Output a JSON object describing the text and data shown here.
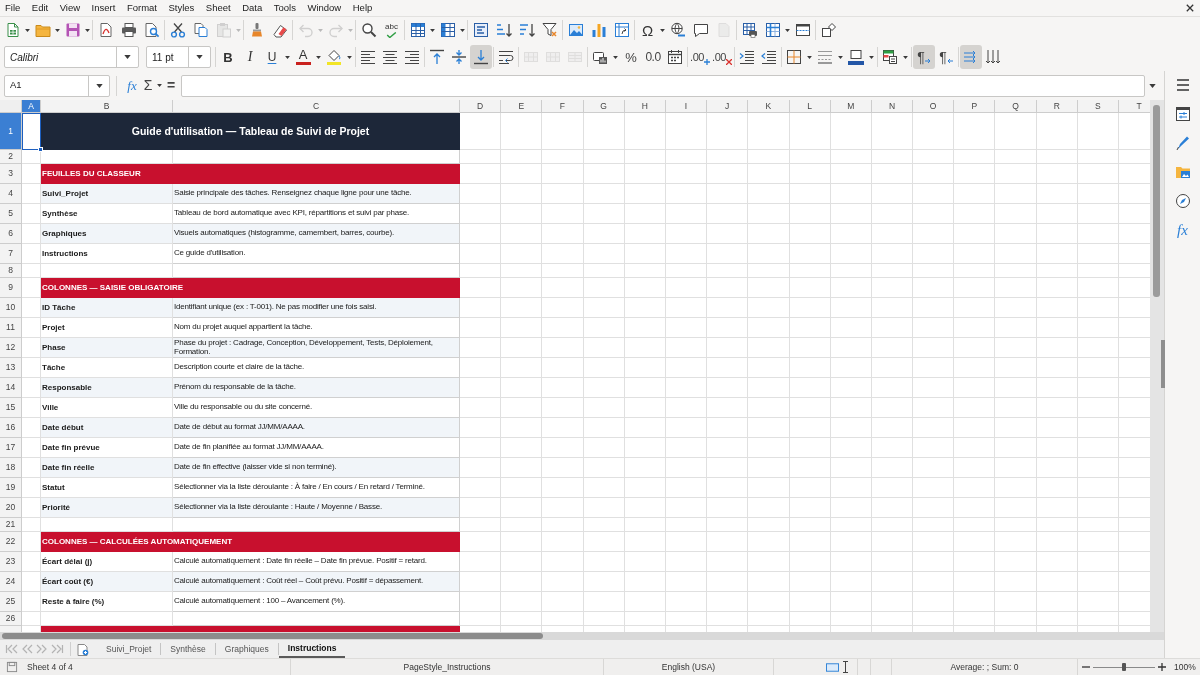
{
  "menu_bar": [
    "File",
    "Edit",
    "View",
    "Insert",
    "Format",
    "Styles",
    "Sheet",
    "Data",
    "Tools",
    "Window",
    "Help"
  ],
  "standard_toolbar": [
    {
      "dropdown": true,
      "disabled": false
    },
    {
      "dropdown": true,
      "disabled": false
    },
    {
      "dropdown": true,
      "disabled": false
    },
    {
      "dropdown": false,
      "disabled": false
    },
    {
      "dropdown": false,
      "disabled": false
    },
    {
      "dropdown": false,
      "disabled": false
    },
    {
      "dropdown": false,
      "disabled": false
    },
    {
      "dropdown": false,
      "disabled": false
    },
    {
      "dropdown": true,
      "disabled": true
    },
    {
      "dropdown": false,
      "disabled": false
    },
    {
      "dropdown": false,
      "disabled": false
    },
    {
      "dropdown": true,
      "disabled": true
    },
    {
      "dropdown": true,
      "disabled": true
    },
    {
      "dropdown": false,
      "disabled": false
    },
    {
      "glyph": "abc",
      "dropdown": false,
      "disabled": false
    },
    {
      "dropdown": true,
      "disabled": false
    },
    {
      "dropdown": true,
      "disabled": false
    },
    {
      "dropdown": false,
      "disabled": false
    },
    {
      "dropdown": false,
      "disabled": false
    },
    {
      "dropdown": false,
      "disabled": false
    },
    {
      "dropdown": false,
      "disabled": false
    },
    {
      "dropdown": false,
      "disabled": false
    },
    {
      "dropdown": false,
      "disabled": false
    },
    {
      "dropdown": false,
      "disabled": false
    },
    {
      "glyph": "Ω",
      "dropdown": true,
      "disabled": false
    },
    {
      "dropdown": false,
      "disabled": false
    },
    {
      "dropdown": false,
      "disabled": false
    },
    {
      "dropdown": false,
      "disabled": true
    },
    {
      "dropdown": false,
      "disabled": false
    },
    {
      "dropdown": true,
      "disabled": false
    },
    {
      "dropdown": false,
      "disabled": false
    },
    {
      "dropdown": false,
      "disabled": false
    }
  ],
  "formatting_toolbar": {
    "font_name": "Calibri",
    "font_size": "11 pt",
    "buttons": [
      {
        "glyph": "B",
        "dropdown": false,
        "disabled": false,
        "active": false
      },
      {
        "glyph": "I",
        "dropdown": false,
        "disabled": false,
        "active": false
      },
      {
        "glyph": "U",
        "dropdown": true,
        "disabled": false,
        "active": false
      },
      {
        "glyph": "A",
        "dropdown": true,
        "disabled": false,
        "active": false
      },
      {
        "dropdown": true,
        "disabled": false,
        "active": false
      },
      {
        "dropdown": false,
        "disabled": false,
        "active": false
      },
      {
        "dropdown": false,
        "disabled": false,
        "active": false
      },
      {
        "dropdown": false,
        "disabled": false,
        "active": false
      },
      {
        "dropdown": false,
        "disabled": false,
        "active": false
      },
      {
        "dropdown": false,
        "disabled": false,
        "active": false
      },
      {
        "dropdown": false,
        "disabled": false,
        "active": true
      },
      {
        "dropdown": false,
        "disabled": false,
        "active": false
      },
      {
        "dropdown": false,
        "disabled": true,
        "active": false
      },
      {
        "dropdown": false,
        "disabled": true,
        "active": false
      },
      {
        "dropdown": false,
        "disabled": true,
        "active": false
      },
      {
        "dropdown": true,
        "disabled": false,
        "active": false
      },
      {
        "glyph": "%",
        "dropdown": false,
        "disabled": false,
        "active": false
      },
      {
        "glyph": "0.0",
        "dropdown": false,
        "disabled": false,
        "active": false
      },
      {
        "dropdown": false,
        "disabled": false,
        "active": false
      },
      {
        "glyph": ".00",
        "dropdown": false,
        "disabled": false,
        "active": false
      },
      {
        "glyph": ".00",
        "dropdown": false,
        "disabled": false,
        "active": false
      },
      {
        "dropdown": false,
        "disabled": false,
        "active": false
      },
      {
        "dropdown": false,
        "disabled": false,
        "active": false
      },
      {
        "dropdown": true,
        "disabled": false,
        "active": false
      },
      {
        "dropdown": true,
        "disabled": false,
        "active": false
      },
      {
        "dropdown": true,
        "disabled": false,
        "active": false
      },
      {
        "dropdown": true,
        "disabled": false,
        "active": false
      },
      {
        "glyph": "¶",
        "dropdown": false,
        "disabled": false,
        "active": true
      },
      {
        "glyph": "¶",
        "dropdown": false,
        "disabled": false,
        "active": false
      },
      {
        "dropdown": false,
        "disabled": false,
        "active": true
      },
      {
        "dropdown": false,
        "disabled": false,
        "active": false
      }
    ]
  },
  "formula_bar": {
    "name_box": "A1",
    "function_glyph": "fx",
    "sum_glyph": "Σ",
    "equals_glyph": "="
  },
  "grid": {
    "columns": [
      {
        "label": "A",
        "selected": true
      },
      {
        "label": "B",
        "selected": false
      },
      {
        "label": "C",
        "selected": false
      },
      {
        "label": "D",
        "selected": false
      },
      {
        "label": "E",
        "selected": false
      },
      {
        "label": "F",
        "selected": false
      },
      {
        "label": "G",
        "selected": false
      },
      {
        "label": "H",
        "selected": false
      },
      {
        "label": "I",
        "selected": false
      },
      {
        "label": "J",
        "selected": false
      },
      {
        "label": "K",
        "selected": false
      },
      {
        "label": "L",
        "selected": false
      },
      {
        "label": "M",
        "selected": false
      },
      {
        "label": "N",
        "selected": false
      },
      {
        "label": "O",
        "selected": false
      },
      {
        "label": "P",
        "selected": false
      },
      {
        "label": "Q",
        "selected": false
      },
      {
        "label": "R",
        "selected": false
      },
      {
        "label": "S",
        "selected": false
      },
      {
        "label": "T",
        "selected": false
      }
    ],
    "rows": [
      {
        "number": "1",
        "kind": "title",
        "label": "Guide d'utilisation — Tableau de Suivi de Projet",
        "selected": true
      },
      {
        "number": "2",
        "kind": "blank",
        "selected": false
      },
      {
        "number": "3",
        "kind": "section",
        "label": "FEUILLES DU CLASSEUR",
        "selected": false
      },
      {
        "number": "4",
        "kind": "entry",
        "label": "Suivi_Projet",
        "description": "Saisie principale des tâches. Renseignez chaque ligne pour une tâche.",
        "shaded": true,
        "selected": false
      },
      {
        "number": "5",
        "kind": "entry",
        "label": "Synthèse",
        "description": "Tableau de bord automatique avec KPI, répartitions et suivi par phase.",
        "shaded": false,
        "selected": false
      },
      {
        "number": "6",
        "kind": "entry",
        "label": "Graphiques",
        "description": "Visuels automatiques (histogramme, camembert, barres, courbe).",
        "shaded": true,
        "selected": false
      },
      {
        "number": "7",
        "kind": "entry",
        "label": "Instructions",
        "description": "Ce guide d'utilisation.",
        "shaded": false,
        "selected": false
      },
      {
        "number": "8",
        "kind": "blank",
        "selected": false
      },
      {
        "number": "9",
        "kind": "section",
        "label": "COLONNES — SAISIE OBLIGATOIRE",
        "selected": false
      },
      {
        "number": "10",
        "kind": "entry",
        "label": "ID Tâche",
        "description": "Identifiant unique (ex : T-001). Ne pas modifier une fois saisi.",
        "shaded": true,
        "selected": false
      },
      {
        "number": "11",
        "kind": "entry",
        "label": "Projet",
        "description": "Nom du projet auquel appartient la tâche.",
        "shaded": false,
        "selected": false
      },
      {
        "number": "12",
        "kind": "entry",
        "label": "Phase",
        "description": "Phase du projet : Cadrage, Conception, Développement, Tests, Déploiement, Formation.",
        "shaded": true,
        "selected": false
      },
      {
        "number": "13",
        "kind": "entry",
        "label": "Tâche",
        "description": "Description courte et claire de la tâche.",
        "shaded": false,
        "selected": false
      },
      {
        "number": "14",
        "kind": "entry",
        "label": "Responsable",
        "description": "Prénom du responsable de la tâche.",
        "shaded": true,
        "selected": false
      },
      {
        "number": "15",
        "kind": "entry",
        "label": "Ville",
        "description": "Ville du responsable ou du site concerné.",
        "shaded": false,
        "selected": false
      },
      {
        "number": "16",
        "kind": "entry",
        "label": "Date début",
        "description": "Date de début au format JJ/MM/AAAA.",
        "shaded": true,
        "selected": false
      },
      {
        "number": "17",
        "kind": "entry",
        "label": "Date fin prévue",
        "description": "Date de fin planifiée au format JJ/MM/AAAA.",
        "shaded": false,
        "selected": false
      },
      {
        "number": "18",
        "kind": "entry",
        "label": "Date fin réelle",
        "description": "Date de fin effective (laisser vide si non terminé).",
        "shaded": true,
        "selected": false
      },
      {
        "number": "19",
        "kind": "entry",
        "label": "Statut",
        "description": "Sélectionner via la liste déroulante : À faire / En cours / En retard / Terminé.",
        "shaded": false,
        "selected": false
      },
      {
        "number": "20",
        "kind": "entry",
        "label": "Priorité",
        "description": "Sélectionner via la liste déroulante : Haute / Moyenne / Basse.",
        "shaded": true,
        "selected": false
      },
      {
        "number": "21",
        "kind": "blank",
        "selected": false
      },
      {
        "number": "22",
        "kind": "section",
        "label": "COLONNES — CALCULÉES AUTOMATIQUEMENT",
        "selected": false
      },
      {
        "number": "23",
        "kind": "entry",
        "label": "Écart délai (j)",
        "description": "Calculé automatiquement : Date fin réelle – Date fin prévue. Positif = retard.",
        "shaded": false,
        "selected": false
      },
      {
        "number": "24",
        "kind": "entry",
        "label": "Écart coût (€)",
        "description": "Calculé automatiquement : Coût réel – Coût prévu. Positif = dépassement.",
        "shaded": true,
        "selected": false
      },
      {
        "number": "25",
        "kind": "entry",
        "label": "Reste à faire (%)",
        "description": "Calculé automatiquement : 100 – Avancement (%).",
        "shaded": false,
        "selected": false
      },
      {
        "number": "26",
        "kind": "blank",
        "selected": false
      },
      {
        "kind": "section",
        "selected": false
      }
    ]
  },
  "sheet_tabs": [
    {
      "label": "Suivi_Projet",
      "selected": false
    },
    {
      "label": "Synthèse",
      "selected": false
    },
    {
      "label": "Graphiques",
      "selected": false
    },
    {
      "label": "Instructions",
      "selected": true
    }
  ],
  "sidebar": {
    "functions_glyph": "fx"
  },
  "status_bar": {
    "sheet_position": "Sheet 4 of 4",
    "page_style": "PageStyle_Instructions",
    "language": "English (USA)",
    "selection_summary": "Average: ; Sum: 0",
    "zoom": "100%",
    "zoom_slider": {
      "level": 0.5
    }
  }
}
